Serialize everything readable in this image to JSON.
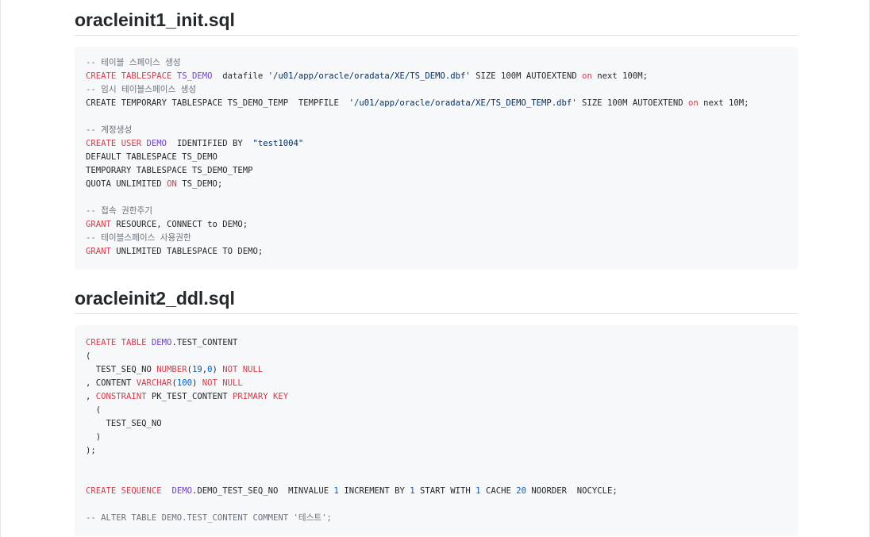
{
  "sections": [
    {
      "title": "oracleinit1_init.sql",
      "lines": [
        [
          [
            "c",
            "-- 테이블 스페이스 생성"
          ]
        ],
        [
          [
            "k",
            "CREATE TABLESPACE "
          ],
          [
            "e",
            "TS_DEMO"
          ],
          [
            "",
            "  datafile "
          ],
          [
            "s",
            "'/u01/app/oracle/oradata/XE/TS_DEMO.dbf'"
          ],
          [
            "",
            " SIZE 100M AUTOEXTEND "
          ],
          [
            "k",
            "on"
          ],
          [
            "",
            " next 100M;"
          ]
        ],
        [
          [
            "c",
            "-- 임시 테이블스페이스 생성"
          ]
        ],
        [
          [
            "",
            "CREATE TEMPORARY TABLESPACE TS_DEMO_TEMP  TEMPFILE  "
          ],
          [
            "s",
            "'/u01/app/oracle/oradata/XE/TS_DEMO_TEMP.dbf'"
          ],
          [
            "",
            " SIZE 100M AUTOEXTEND "
          ],
          [
            "k",
            "on"
          ],
          [
            "",
            " next 10M;"
          ]
        ],
        [],
        [
          [
            "c",
            "-- 계정생성"
          ]
        ],
        [
          [
            "k",
            "CREATE USER "
          ],
          [
            "e",
            "DEMO"
          ],
          [
            "",
            "  IDENTIFIED BY  "
          ],
          [
            "s",
            "\"test1004\""
          ]
        ],
        [
          [
            "",
            "DEFAULT TABLESPACE TS_DEMO"
          ]
        ],
        [
          [
            "",
            "TEMPORARY TABLESPACE TS_DEMO_TEMP"
          ]
        ],
        [
          [
            "",
            "QUOTA UNLIMITED "
          ],
          [
            "k",
            "ON"
          ],
          [
            "",
            " TS_DEMO;"
          ]
        ],
        [],
        [
          [
            "c",
            "-- 접속 권한주기"
          ]
        ],
        [
          [
            "k",
            "GRANT"
          ],
          [
            "",
            " RESOURCE, CONNECT to DEMO;"
          ]
        ],
        [
          [
            "c",
            "-- 테이블스페이스 사용권한"
          ]
        ],
        [
          [
            "k",
            "GRANT"
          ],
          [
            "",
            " UNLIMITED TABLESPACE TO DEMO;"
          ]
        ]
      ]
    },
    {
      "title": "oracleinit2_ddl.sql",
      "lines": [
        [
          [
            "k",
            "CREATE TABLE "
          ],
          [
            "e",
            "DEMO"
          ],
          [
            "",
            ".TEST_CONTENT"
          ]
        ],
        [
          [
            "",
            "("
          ]
        ],
        [
          [
            "",
            "  TEST_SEQ_NO "
          ],
          [
            "k",
            "NUMBER"
          ],
          [
            "",
            "("
          ],
          [
            "n",
            "19"
          ],
          [
            "",
            ","
          ],
          [
            "n",
            "0"
          ],
          [
            "",
            ") "
          ],
          [
            "k",
            "NOT NULL"
          ]
        ],
        [
          [
            "",
            ", CONTENT "
          ],
          [
            "k",
            "VARCHAR"
          ],
          [
            "",
            "("
          ],
          [
            "n",
            "100"
          ],
          [
            "",
            ") "
          ],
          [
            "k",
            "NOT NULL"
          ]
        ],
        [
          [
            "",
            ", "
          ],
          [
            "k",
            "CONSTRAINT"
          ],
          [
            "",
            " PK_TEST_CONTENT "
          ],
          [
            "k",
            "PRIMARY KEY"
          ]
        ],
        [
          [
            "",
            "  ("
          ]
        ],
        [
          [
            "",
            "    TEST_SEQ_NO"
          ]
        ],
        [
          [
            "",
            "  )"
          ]
        ],
        [
          [
            "",
            ");"
          ]
        ],
        [],
        [],
        [
          [
            "k",
            "CREATE SEQUENCE  "
          ],
          [
            "e",
            "DEMO"
          ],
          [
            "",
            ".DEMO_TEST_SEQ_NO  MINVALUE "
          ],
          [
            "n",
            "1"
          ],
          [
            "",
            " INCREMENT BY "
          ],
          [
            "n",
            "1"
          ],
          [
            "",
            " START WITH "
          ],
          [
            "n",
            "1"
          ],
          [
            "",
            " CACHE "
          ],
          [
            "n",
            "20"
          ],
          [
            "",
            " NOORDER  NOCYCLE;"
          ]
        ],
        [],
        [
          [
            "c",
            "-- ALTER TABLE DEMO.TEST_CONTENT COMMENT '테스트';"
          ]
        ]
      ]
    }
  ]
}
